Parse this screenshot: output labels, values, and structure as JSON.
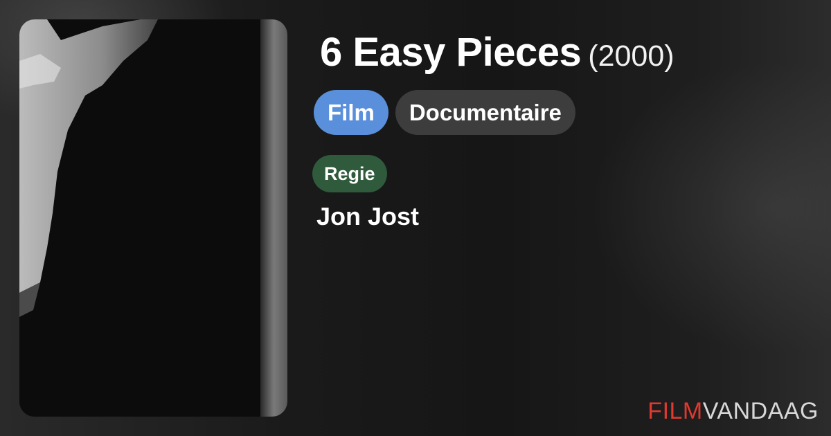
{
  "movie": {
    "title": "6 Easy Pieces",
    "year": "(2000)"
  },
  "tags": {
    "type": "Film",
    "genre": "Documentaire"
  },
  "credits": {
    "role": "Regie",
    "person": "Jon Jost"
  },
  "brand": {
    "film": "FILM",
    "vandaag": "VANDAAG"
  },
  "colors": {
    "type_tag": "#5a8fdc",
    "genre_tag": "#3d3d3d",
    "role_badge": "#2f5a3c",
    "brand_accent": "#e03a2f"
  }
}
